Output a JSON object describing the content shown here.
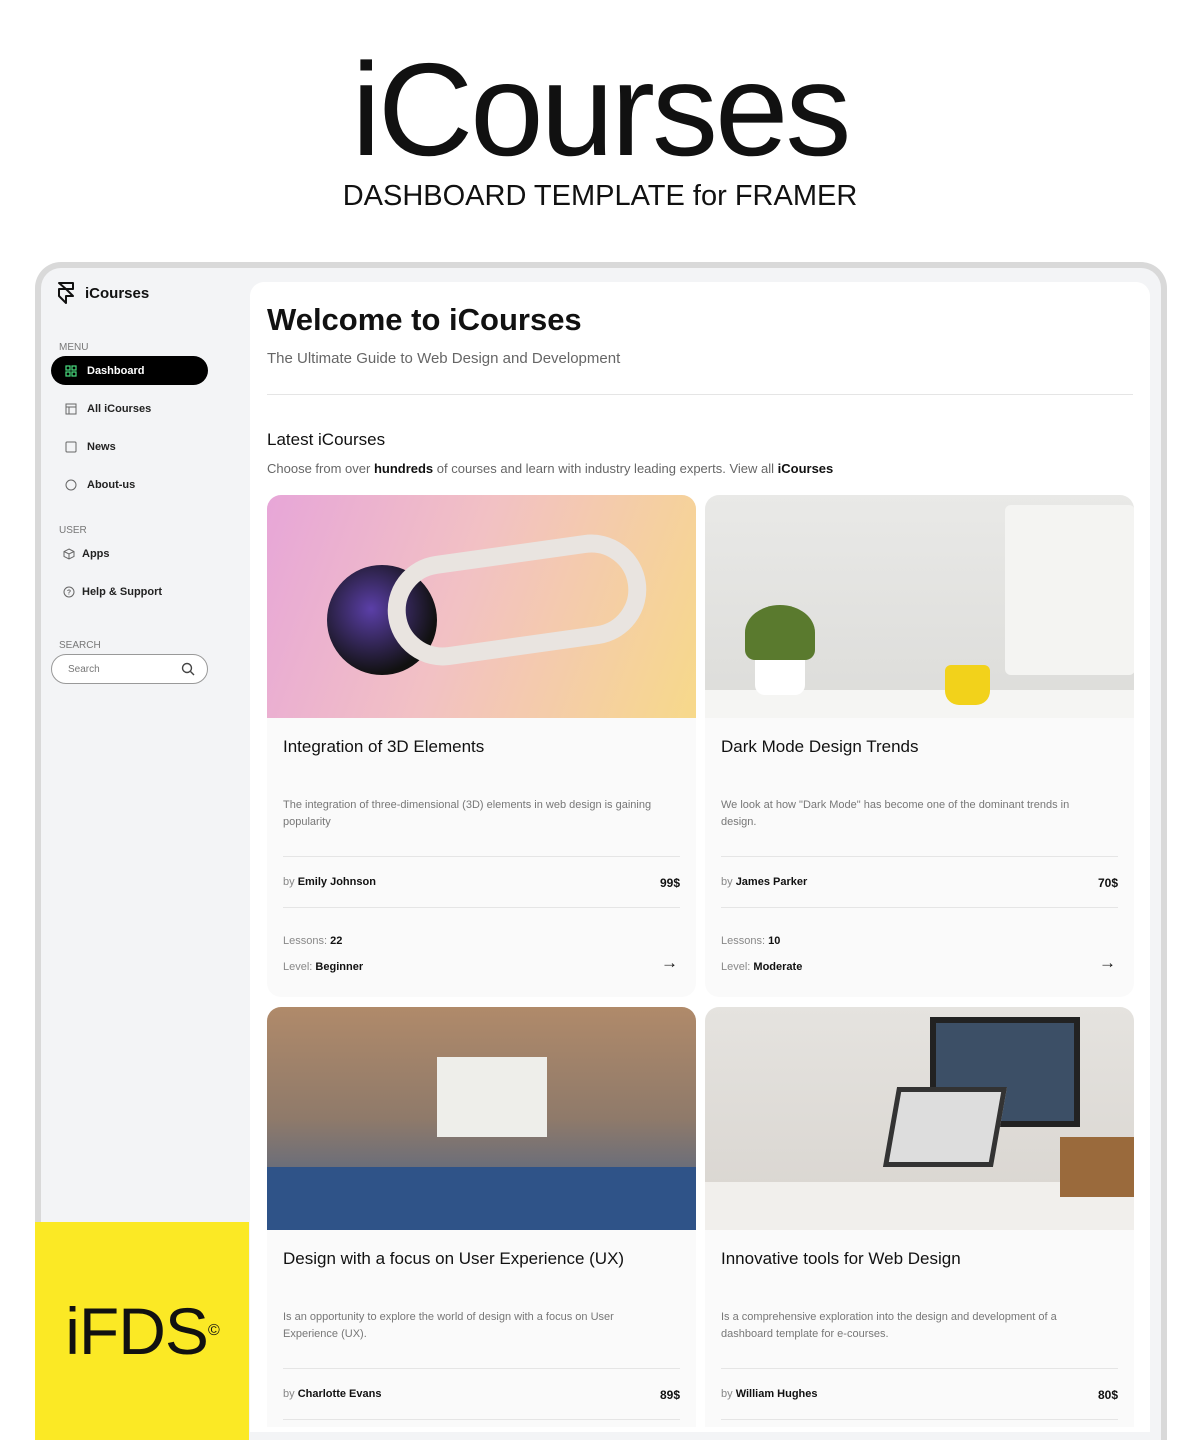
{
  "hero": {
    "title": "iCourses",
    "subtitle": "DASHBOARD TEMPLATE for FRAMER"
  },
  "sidebar": {
    "brand": "iCourses",
    "menu_label": "MENU",
    "menu": [
      {
        "label": "Dashboard",
        "icon": "grid-icon",
        "active": true
      },
      {
        "label": "All iCourses",
        "icon": "layout-icon"
      },
      {
        "label": "News",
        "icon": "square-icon"
      },
      {
        "label": "About-us",
        "icon": "circle-icon"
      }
    ],
    "user_label": "USER",
    "user": [
      {
        "label": "Apps",
        "icon": "cube-icon"
      },
      {
        "label": "Help & Support",
        "icon": "help-icon"
      }
    ],
    "search_label": "SEARCH",
    "search_placeholder": "Search"
  },
  "main": {
    "title": "Welcome to iCourses",
    "subtitle": "The Ultimate Guide to Web Design and Development",
    "section_title": "Latest iCourses",
    "section_sub": {
      "a": "Choose from over ",
      "b": "hundreds",
      "c": " of courses and learn with industry leading experts. View all ",
      "d": "iCourses"
    },
    "by": "by",
    "lessons_label": "Lessons:",
    "level_label": "Level:",
    "cards": [
      {
        "title": "Integration of 3D Elements",
        "desc": "The integration of three-dimensional (3D) elements in web design is gaining popularity",
        "author": "Emily Johnson",
        "price": "99$",
        "lessons": "22",
        "level": "Beginner"
      },
      {
        "title": "Dark Mode Design Trends",
        "desc": "We look at how \"Dark Mode\" has become one of the dominant trends in design.",
        "author": "James Parker",
        "price": "70$",
        "lessons": "10",
        "level": "Moderate"
      },
      {
        "title": "Design with a focus on User Experience (UX)",
        "desc": "Is an opportunity to explore the world of design with a focus on User Experience (UX).",
        "author": "Charlotte Evans",
        "price": "89$"
      },
      {
        "title": "Innovative tools for Web Design",
        "desc": "Is a comprehensive exploration into the design and development of a dashboard template for e-courses.",
        "author": "William Hughes",
        "price": "80$"
      }
    ]
  },
  "badge": {
    "text": "iFDS",
    "mark": "©"
  },
  "colors": {
    "badge_bg": "#fbe925",
    "active_nav": "#000000",
    "active_icon": "#4ade80"
  }
}
